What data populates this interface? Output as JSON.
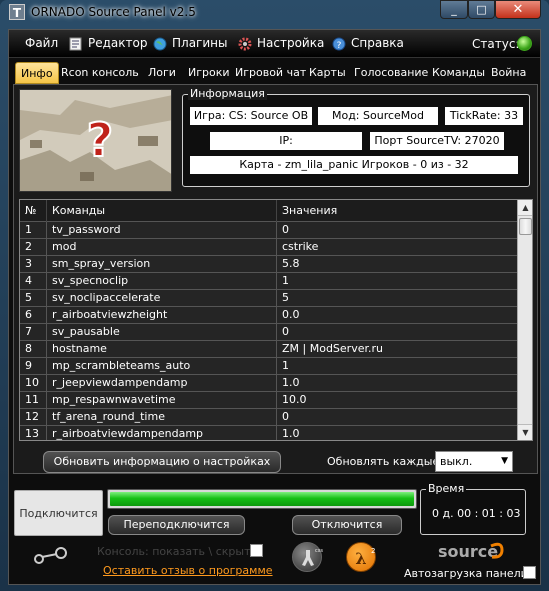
{
  "window": {
    "title": "ORNADO Source Panel v2.5",
    "app_icon": "T"
  },
  "title_buttons": {
    "minimize": "_",
    "maximize": "□",
    "close": "✕"
  },
  "menu": {
    "items": [
      {
        "label": "Файл",
        "icon": ""
      },
      {
        "label": "Редактор",
        "icon": "notepad-icon"
      },
      {
        "label": "Плагины",
        "icon": "globe-icon"
      },
      {
        "label": "Настройка",
        "icon": "gear-icon"
      },
      {
        "label": "Справка",
        "icon": "help-icon"
      }
    ],
    "status_label": "Статус:",
    "status_color": "#3fa81c"
  },
  "tabs": [
    "Инфо",
    "Rcon консоль",
    "Логи",
    "Игроки",
    "Игровой чат",
    "Карты",
    "Голосование",
    "Команды",
    "Война"
  ],
  "active_tab": "Инфо",
  "info": {
    "caption": "Информация",
    "game": "Игра: CS: Source OB",
    "mod": "Мод: SourceMod",
    "tickrate": "TickRate: 33",
    "ip": "IP:",
    "port": "Порт SourceTV:  27020",
    "map_players": "Карта - zm_lila_panic   Игроков - 0   из - 32"
  },
  "grid": {
    "headers": [
      "№",
      "Команды",
      "Значения"
    ],
    "rows": [
      [
        "1",
        "tv_password",
        "0"
      ],
      [
        "2",
        "mod",
        "cstrike"
      ],
      [
        "3",
        "sm_spray_version",
        "5.8"
      ],
      [
        "4",
        "sv_specnoclip",
        "1"
      ],
      [
        "5",
        "sv_noclipaccelerate",
        "5"
      ],
      [
        "6",
        "r_airboatviewzheight",
        "0.0"
      ],
      [
        "7",
        "sv_pausable",
        "0"
      ],
      [
        "8",
        "hostname",
        "ZM | ModServer.ru"
      ],
      [
        "9",
        "mp_scrambleteams_auto",
        "1"
      ],
      [
        "10",
        "r_jeepviewdampendamp",
        "1.0"
      ],
      [
        "11",
        "mp_respawnwavetime",
        "10.0"
      ],
      [
        "12",
        "tf_arena_round_time",
        "0"
      ],
      [
        "13",
        "r_airboatviewdampendamp",
        "1.0"
      ]
    ]
  },
  "controls": {
    "refresh_label": "Обновить информацию о настройках",
    "update_label": "Обновлять каждые:",
    "update_value": "выкл.",
    "connect_label": "Подключится",
    "progress_fraction": 1.0,
    "reconnect_label": "Переподключится",
    "disconnect_label": "Отключится",
    "time_caption": "Время",
    "time_value": "0 д.   00 : 01 : 03",
    "console_label": "Консоль: показать \\ скрыть",
    "feedback_label": "Оставить отзыв о программе",
    "source_logo": "source",
    "autoload_label": "Автозагрузка панели"
  }
}
